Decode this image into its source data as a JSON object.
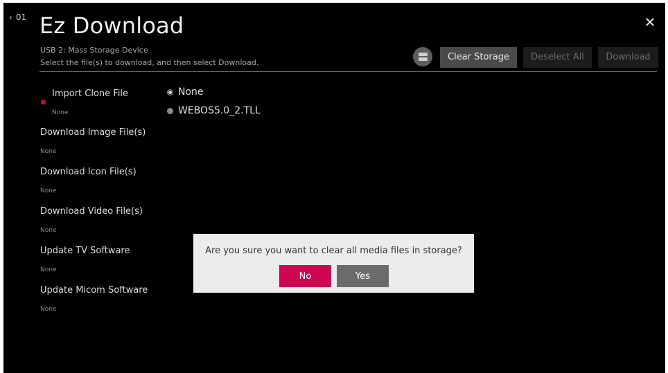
{
  "nav": {
    "back_label": "01"
  },
  "header": {
    "title": "Ez Download",
    "device": "USB 2: Mass Storage Device",
    "instruction": "Select the file(s) to download, and then select Download."
  },
  "toolbar": {
    "storage_icon": "storage-icon",
    "clear_storage": "Clear Storage",
    "deselect_all": "Deselect All",
    "download": "Download"
  },
  "menu": [
    {
      "label": "Import Clone File",
      "value": "None"
    },
    {
      "label": "Download Image File(s)",
      "value": "None"
    },
    {
      "label": "Download Icon File(s)",
      "value": "None"
    },
    {
      "label": "Download Video File(s)",
      "value": "None"
    },
    {
      "label": "Update TV Software",
      "value": "None"
    },
    {
      "label": "Update Micom Software",
      "value": "None"
    }
  ],
  "options": [
    {
      "label": "None",
      "selected": true
    },
    {
      "label": "WEBOS5.0_2.TLL",
      "selected": false
    }
  ],
  "dialog": {
    "message": "Are you sure you want to clear all media files in storage?",
    "no_label": "No",
    "yes_label": "Yes"
  },
  "colors": {
    "accent": "#cf0652",
    "background": "#000000",
    "dialog_bg": "#ececec"
  }
}
